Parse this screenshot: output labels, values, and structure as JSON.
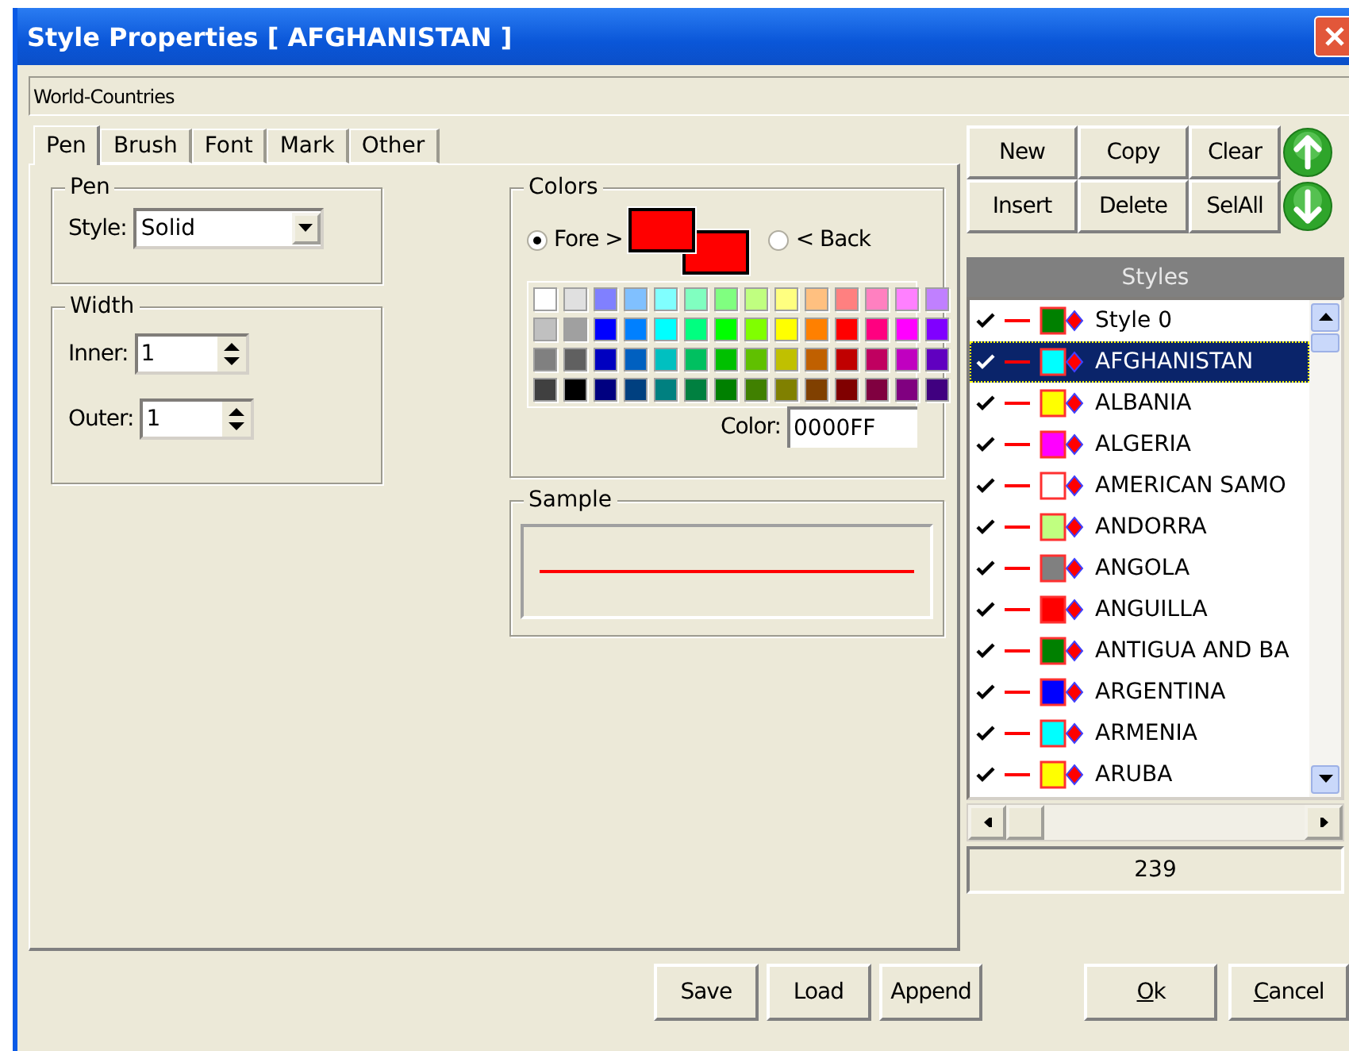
{
  "window": {
    "title": "Style Properties [ AFGHANISTAN ]"
  },
  "layer_name": "World-Countries",
  "tabs": [
    {
      "label": "Pen",
      "selected": true
    },
    {
      "label": "Brush",
      "selected": false
    },
    {
      "label": "Font",
      "selected": false
    },
    {
      "label": "Mark",
      "selected": false
    },
    {
      "label": "Other",
      "selected": false
    }
  ],
  "pen_group": {
    "title": "Pen",
    "style_label": "Style:",
    "style_value": "Solid"
  },
  "width_group": {
    "title": "Width",
    "fields": [
      {
        "label": "Inner:",
        "value": "1"
      },
      {
        "label": "Outer:",
        "value": "1"
      }
    ]
  },
  "colors_group": {
    "title": "Colors",
    "fore": {
      "label": "Fore >",
      "selected": true,
      "color": "#ff0000"
    },
    "back": {
      "label": "< Back",
      "selected": false,
      "color": "#ff0000"
    },
    "palette": [
      [
        {
          "color": "#ffffff"
        },
        {
          "color": "#e0e0e0"
        },
        {
          "color": "#8080ff"
        },
        {
          "color": "#80c0ff"
        },
        {
          "color": "#80ffff"
        },
        {
          "color": "#80ffc0"
        },
        {
          "color": "#80ff80"
        },
        {
          "color": "#c0ff80"
        },
        {
          "color": "#ffff80"
        },
        {
          "color": "#ffc080"
        },
        {
          "color": "#ff8080"
        },
        {
          "color": "#ff80c0"
        },
        {
          "color": "#ff80ff"
        },
        {
          "color": "#c080ff"
        }
      ],
      [
        {
          "color": "#c0c0c0"
        },
        {
          "color": "#a0a0a0"
        },
        {
          "color": "#0000ff"
        },
        {
          "color": "#0080ff"
        },
        {
          "color": "#00ffff"
        },
        {
          "color": "#00ff80"
        },
        {
          "color": "#00ff00"
        },
        {
          "color": "#80ff00"
        },
        {
          "color": "#ffff00"
        },
        {
          "color": "#ff8000"
        },
        {
          "color": "#ff0000"
        },
        {
          "color": "#ff0080"
        },
        {
          "color": "#ff00ff"
        },
        {
          "color": "#8000ff"
        }
      ],
      [
        {
          "color": "#808080"
        },
        {
          "color": "#606060"
        },
        {
          "color": "#0000c0"
        },
        {
          "color": "#0060c0"
        },
        {
          "color": "#00c0c0"
        },
        {
          "color": "#00c060"
        },
        {
          "color": "#00c000"
        },
        {
          "color": "#60c000"
        },
        {
          "color": "#c0c000"
        },
        {
          "color": "#c06000"
        },
        {
          "color": "#c00000"
        },
        {
          "color": "#c00060"
        },
        {
          "color": "#c000c0"
        },
        {
          "color": "#6000c0"
        }
      ],
      [
        {
          "color": "#404040"
        },
        {
          "color": "#000000"
        },
        {
          "color": "#000080"
        },
        {
          "color": "#004080"
        },
        {
          "color": "#008080"
        },
        {
          "color": "#008040"
        },
        {
          "color": "#008000"
        },
        {
          "color": "#408000"
        },
        {
          "color": "#808000"
        },
        {
          "color": "#804000"
        },
        {
          "color": "#800000"
        },
        {
          "color": "#800040"
        },
        {
          "color": "#800080"
        },
        {
          "color": "#400080"
        }
      ]
    ],
    "color_label": "Color:",
    "color_value": "0000FF"
  },
  "sample_group": {
    "title": "Sample"
  },
  "list_buttons": [
    "New",
    "Copy",
    "Clear",
    "Insert",
    "Delete",
    "SelAll"
  ],
  "styles": {
    "header": "Styles",
    "items": [
      {
        "name": "Style 0",
        "checked": true,
        "selected": false,
        "color": "#008000"
      },
      {
        "name": "AFGHANISTAN",
        "checked": true,
        "selected": true,
        "color": "#00ffff"
      },
      {
        "name": "ALBANIA",
        "checked": true,
        "selected": false,
        "color": "#ffff00"
      },
      {
        "name": "ALGERIA",
        "checked": true,
        "selected": false,
        "color": "#ff00ff"
      },
      {
        "name": "AMERICAN SAMO",
        "checked": true,
        "selected": false,
        "color": "#ffffff"
      },
      {
        "name": "ANDORRA",
        "checked": true,
        "selected": false,
        "color": "#c0ff80"
      },
      {
        "name": "ANGOLA",
        "checked": true,
        "selected": false,
        "color": "#808080"
      },
      {
        "name": "ANGUILLA",
        "checked": true,
        "selected": false,
        "color": "#ff0000"
      },
      {
        "name": "ANTIGUA AND BA",
        "checked": true,
        "selected": false,
        "color": "#008000"
      },
      {
        "name": "ARGENTINA",
        "checked": true,
        "selected": false,
        "color": "#0000ff"
      },
      {
        "name": "ARMENIA",
        "checked": true,
        "selected": false,
        "color": "#00ffff"
      },
      {
        "name": "ARUBA",
        "checked": true,
        "selected": false,
        "color": "#ffff00"
      }
    ],
    "count": "239"
  },
  "file_buttons": [
    "Save",
    "Load",
    "Append"
  ],
  "dialog_buttons": [
    {
      "label": "Ok",
      "underlined_access_key": true
    },
    {
      "label": "Cancel",
      "underlined_access_key": true
    }
  ]
}
